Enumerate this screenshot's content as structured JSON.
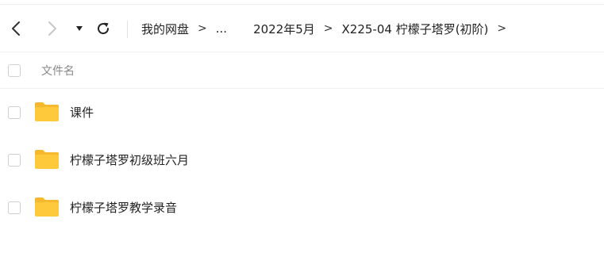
{
  "navbar": {
    "back_icon": "chevron-left-icon",
    "forward_icon": "chevron-right-icon",
    "dropdown_icon": "caret-down-icon",
    "refresh_icon": "refresh-icon",
    "breadcrumb": [
      "我的网盘",
      "...",
      "2022年5月",
      "X225-04 柠檬子塔罗(初阶)"
    ],
    "separator": ">"
  },
  "file_list": {
    "header": {
      "name_column": "文件名"
    },
    "items": [
      {
        "name": "课件",
        "icon": "folder-icon"
      },
      {
        "name": "柠檬子塔罗初级班六月",
        "icon": "folder-icon"
      },
      {
        "name": "柠檬子塔罗教学录音",
        "icon": "folder-icon"
      }
    ]
  },
  "colors": {
    "folder": "#FFC93C",
    "folder_tab": "#F5B82E",
    "checkbox_border": "#CFCFCF",
    "divider": "#F0F0F0"
  }
}
